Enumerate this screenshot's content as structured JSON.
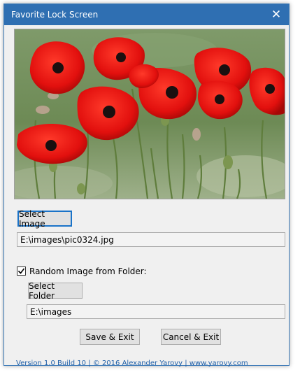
{
  "window": {
    "title": "Favorite Lock Screen",
    "close_label": "✕"
  },
  "preview": {
    "description_icon": "poppy-photo"
  },
  "image": {
    "select_label": "Select Image",
    "path": "E:\\images\\pic0324.jpg"
  },
  "folder": {
    "checkbox_checked": true,
    "checkbox_label": "Random Image from Folder:",
    "select_label": "Select Folder",
    "path": "E:\\images"
  },
  "actions": {
    "save_label": "Save & Exit",
    "cancel_label": "Cancel & Exit"
  },
  "footer": {
    "text": "Version 1.0 Build 10 | © 2016 Alexander Yarovy | www.yarovy.com"
  },
  "colors": {
    "accent": "#2f6fb2",
    "focus": "#1a73c8",
    "footer_text": "#1f5fa8"
  }
}
